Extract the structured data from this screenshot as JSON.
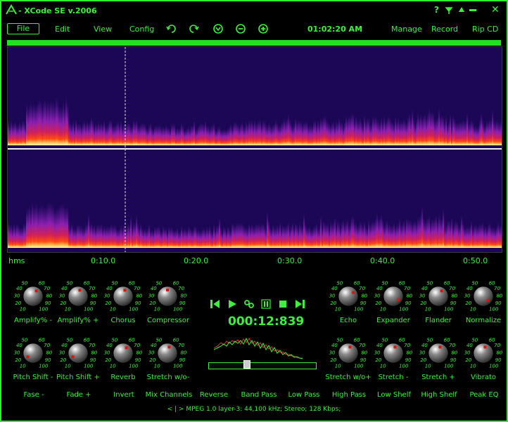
{
  "titlebar": {
    "title": "- XCode SE v.2006",
    "help": "?",
    "close": "✕"
  },
  "menu": {
    "file": "File",
    "edit": "Edit",
    "view": "View",
    "config": "Config",
    "clock": "01:02:20 AM",
    "manage": "Manage",
    "record": "Record",
    "rip": "Rip CD"
  },
  "ruler": [
    "hms",
    "0:10.0",
    "0:20.0",
    "0:30.0",
    "0:40.0",
    "0:50.0"
  ],
  "knob_scale": [
    "10",
    "20",
    "30",
    "40",
    "50",
    "60",
    "70",
    "80",
    "90",
    "100"
  ],
  "knobs_left": [
    {
      "label": "Amplify% -",
      "value": 65
    },
    {
      "label": "Amplify% +",
      "value": 60
    },
    {
      "label": "Chorus",
      "value": 60
    },
    {
      "label": "Compressor",
      "value": 55
    },
    {
      "label": "Pitch Shift -",
      "value": 15
    },
    {
      "label": "Pitch Shift +",
      "value": 15
    },
    {
      "label": "Reverb",
      "value": 65
    },
    {
      "label": "Stretch w/o-",
      "value": 60
    }
  ],
  "knobs_right": [
    {
      "label": "Echo",
      "value": 72
    },
    {
      "label": "Expander",
      "value": 95
    },
    {
      "label": "Flander",
      "value": 65
    },
    {
      "label": "Normalize",
      "value": 97
    },
    {
      "label": "Stretch w/o+",
      "value": 60
    },
    {
      "label": "Stretch -",
      "value": 60
    },
    {
      "label": "Stretch +",
      "value": 60
    },
    {
      "label": "Vibrato",
      "value": 60
    }
  ],
  "transport": {
    "time": "000:12:839",
    "position": 0.36
  },
  "fx_buttons": [
    "Fase -",
    "Fade +",
    "Invert",
    "Mix Channels",
    "Reverse",
    "Band Pass",
    "Low Pass",
    "High Pass",
    "Low Shelf",
    "High Shelf",
    "Peak EQ"
  ],
  "status": "< | >  MPEG 1.0 layer-3: 44,100 kHz; Stereo; 128 Kbps;",
  "colors": {
    "accent": "#3cf03c",
    "spectrum_bg": "#1b0755",
    "knob_indicator": "#e01010"
  }
}
